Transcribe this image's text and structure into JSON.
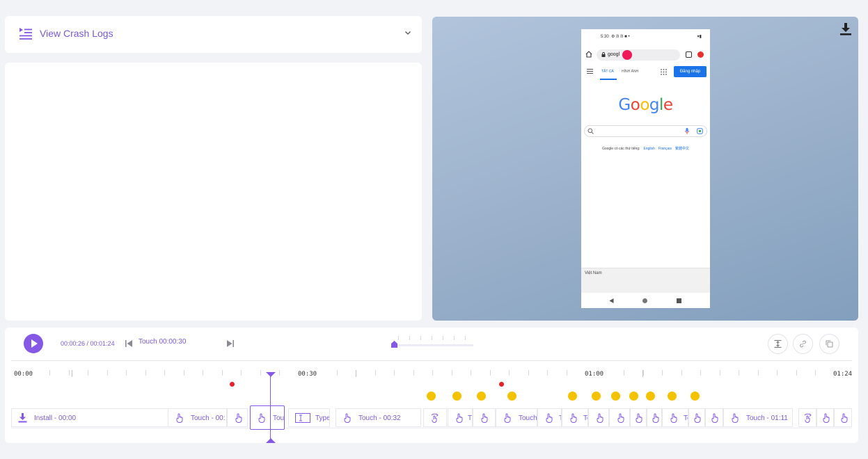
{
  "crash_panel": {
    "title": "View Crash Logs"
  },
  "device": {
    "status_time": "5:30",
    "status_icons": "⚙ 𝔹 𝔹 ■ •",
    "status_right": "▾▮",
    "url_text": "googl",
    "url_suffix": "ı",
    "tab_all": "TẤT CẢ",
    "tab_images": "HÌNH ẢNH",
    "signin_label": "Đăng nhập",
    "logo_letters": [
      "G",
      "o",
      "o",
      "g",
      "l",
      "e"
    ],
    "logo_colors": [
      "#4285f4",
      "#ea4335",
      "#fbbc05",
      "#4285f4",
      "#34a853",
      "#ea4335"
    ],
    "offered_in": "Google có các thứ tiếng:",
    "languages": [
      "English",
      "Français",
      "繁體中文"
    ],
    "footer_country": "Việt Nam"
  },
  "player": {
    "time": "00:00:26 / 00:01:24",
    "current_event": "Touch 00:00:30",
    "speed_fraction": 0
  },
  "timeline": {
    "ruler_labels": [
      "00:00",
      "00:30",
      "01:00",
      "01:24"
    ],
    "crash_marker_color": "#e8202a",
    "warning_marker_color": "#f3c200",
    "accent_color": "#8559e6",
    "events": [
      {
        "type": "install",
        "label": "Install - 00:00"
      },
      {
        "type": "touch",
        "label": "Touch - 00:"
      },
      {
        "type": "touch",
        "label": ""
      },
      {
        "type": "touch",
        "label": "Tou"
      },
      {
        "type": "type",
        "label": "Type"
      },
      {
        "type": "touch",
        "label": "Touch - 00:32"
      },
      {
        "type": "swipe",
        "label": ""
      },
      {
        "type": "touch",
        "label": "T"
      },
      {
        "type": "touch",
        "label": ""
      },
      {
        "type": "touch",
        "label": "Touch"
      },
      {
        "type": "touch",
        "label": "T"
      },
      {
        "type": "touch",
        "label": "To"
      },
      {
        "type": "touch",
        "label": ""
      },
      {
        "type": "touch",
        "label": ""
      },
      {
        "type": "touch",
        "label": ""
      },
      {
        "type": "touch",
        "label": ""
      },
      {
        "type": "touch",
        "label": "To"
      },
      {
        "type": "touch",
        "label": ""
      },
      {
        "type": "touch",
        "label": ""
      },
      {
        "type": "touch",
        "label": "Touch - 01:11"
      },
      {
        "type": "swipe",
        "label": ""
      },
      {
        "type": "touch",
        "label": ""
      },
      {
        "type": "touch",
        "label": ""
      }
    ]
  },
  "icons": {
    "crash_log": "list-indent-icon",
    "expand": "chevron-down-icon",
    "download": "download-icon",
    "play": "play-icon",
    "prev": "skip-previous-icon",
    "next": "skip-next-icon",
    "fit": "fit-height-icon",
    "link": "link-icon",
    "copy": "copy-icon",
    "touch": "hand-pointer-icon",
    "install": "download-icon",
    "type": "text-cursor-icon",
    "swipe": "swipe-icon"
  }
}
